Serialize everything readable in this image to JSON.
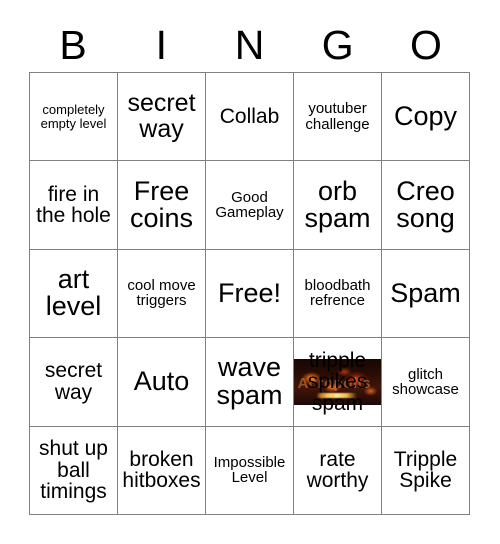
{
  "card": {
    "header_letters": [
      "B",
      "I",
      "N",
      "G",
      "O"
    ],
    "free_space_index": 12,
    "image_cell_index": 18,
    "colors": {
      "grid_line": "#808080",
      "text": "#000000",
      "background": "#ffffff",
      "ember_dark": "#160704",
      "ember_mid": "#43150a",
      "ember_glow": "#ff8c20",
      "ember_highlight": "#ffe696"
    },
    "cells": [
      {
        "text": "completely empty level",
        "size": "xs"
      },
      {
        "text": "secret way",
        "size": "lg"
      },
      {
        "text": "Collab",
        "size": "md"
      },
      {
        "text": "youtuber challenge",
        "size": "sm"
      },
      {
        "text": "Copy",
        "size": "xl"
      },
      {
        "text": "fire in the hole",
        "size": "md"
      },
      {
        "text": "Free coins",
        "size": "xl"
      },
      {
        "text": "Good Gameplay",
        "size": "sm"
      },
      {
        "text": "orb spam",
        "size": "xl"
      },
      {
        "text": "Creo song",
        "size": "xl"
      },
      {
        "text": "art level",
        "size": "xl"
      },
      {
        "text": "cool move triggers",
        "size": "sm"
      },
      {
        "text": "Free!",
        "size": "xl"
      },
      {
        "text": "bloodbath refrence",
        "size": "sm"
      },
      {
        "text": "Spam",
        "size": "xl"
      },
      {
        "text": "secret way",
        "size": "md"
      },
      {
        "text": "Auto",
        "size": "xl"
      },
      {
        "text": "wave spam",
        "size": "xl"
      },
      {
        "text": "tripple spikes spam",
        "size": "md",
        "image": "fire-embers-banner"
      },
      {
        "text": "glitch showcase",
        "size": "sm"
      },
      {
        "text": "shut up ball timings",
        "size": "md"
      },
      {
        "text": "broken hitboxes",
        "size": "md"
      },
      {
        "text": "Impossible Level",
        "size": "sm"
      },
      {
        "text": "rate worthy",
        "size": "md"
      },
      {
        "text": "Tripple Spike",
        "size": "md"
      }
    ]
  }
}
